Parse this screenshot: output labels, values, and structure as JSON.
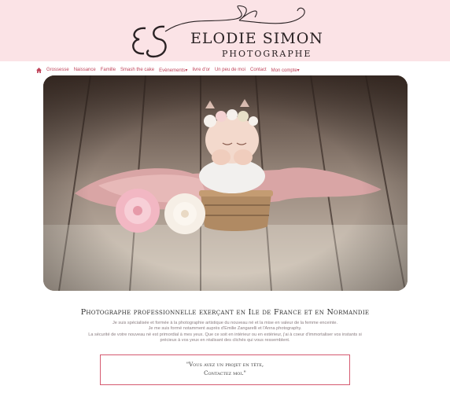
{
  "brand": {
    "monogram": "ES",
    "name": "Elodie Simon",
    "tagline": "Photographe"
  },
  "nav": {
    "items": [
      {
        "label": "Grossesse"
      },
      {
        "label": "Naissance"
      },
      {
        "label": "Famille"
      },
      {
        "label": "Smash the cake"
      },
      {
        "label": "Evènements▾"
      },
      {
        "label": "livre d'or"
      },
      {
        "label": "Un peu de moi"
      },
      {
        "label": "Contact"
      },
      {
        "label": "Mon compte▾"
      }
    ]
  },
  "hero": {
    "icon": "newborn-photo"
  },
  "content": {
    "headline": "Photographe professionnelle exerçant en Ile de France et en Normandie",
    "intro": [
      "Je suis spécialisée et formée à la photographie artistique du nouveau né et la mise en valeur de la femme enceinte.",
      "Je me suis formé notamment auprès d'Emilie Zangarelli et l'Anna photography.",
      "La sécurité de votre nouveau né est primordial à mes yeux. Que ce soit en intérieur ou en extérieur, j'ai à coeur d'immortaliser vos instants si",
      "précieux à vos yeux en réalisant des clichés qui vous ressemblent."
    ],
    "cta_line1": "\"Vous avez un projet en tête,",
    "cta_line2": "Contactez moi.\""
  },
  "colors": {
    "header_bg": "#fbe3e6",
    "accent": "#c0455b"
  }
}
